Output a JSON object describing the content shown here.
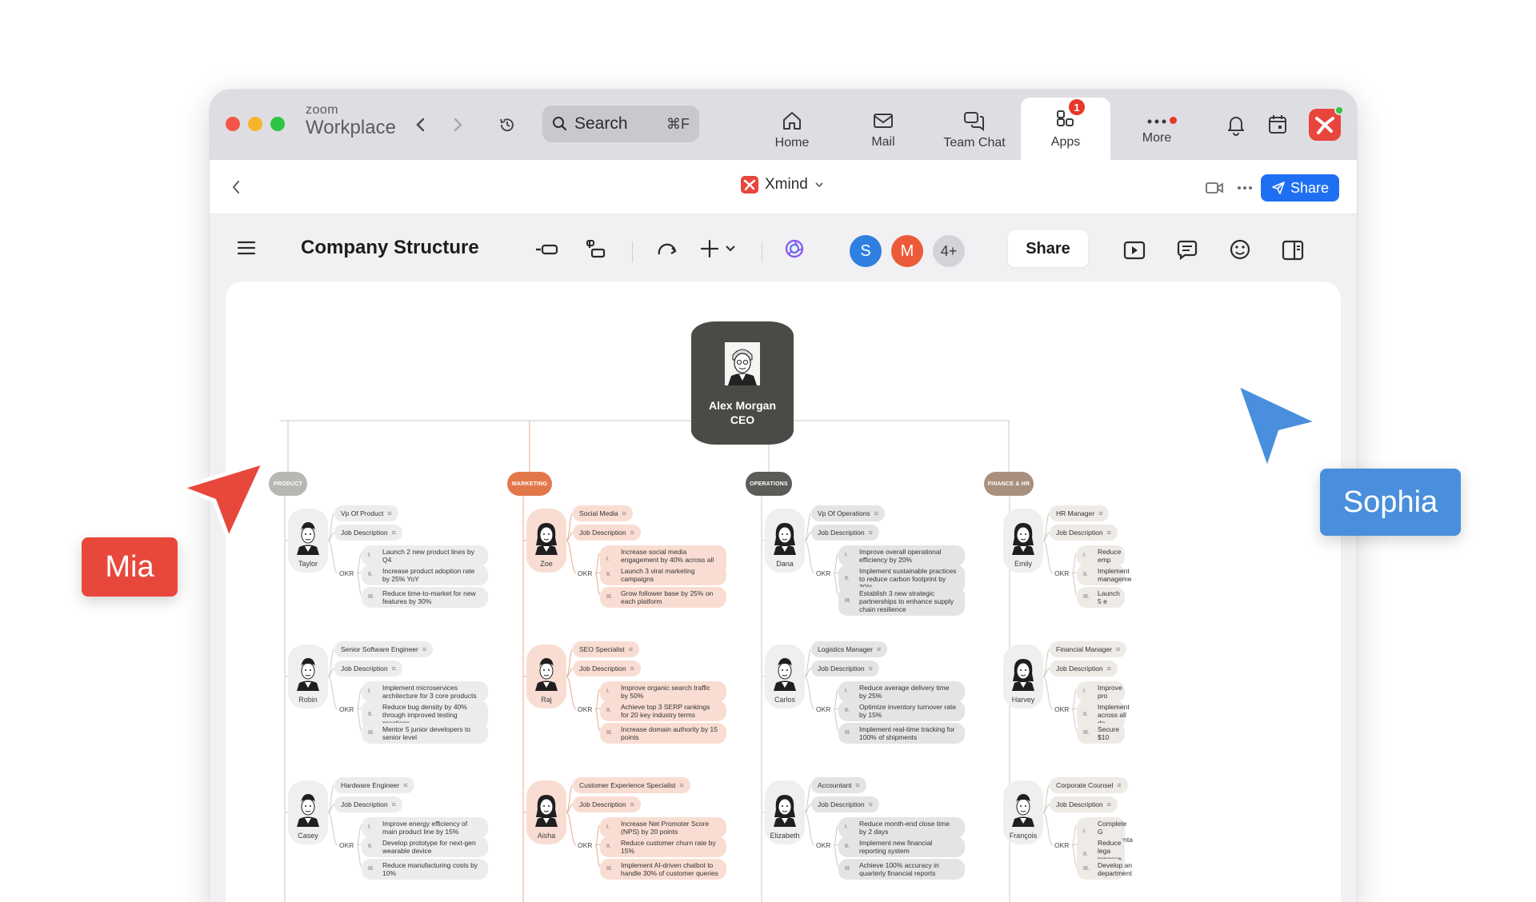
{
  "app": {
    "brand_top": "zoom",
    "brand_bottom": "Workplace",
    "search": {
      "placeholder": "Search",
      "shortcut": "⌘F"
    },
    "nav": [
      {
        "label": "Home",
        "icon": "home-icon"
      },
      {
        "label": "Mail",
        "icon": "mail-icon"
      },
      {
        "label": "Team Chat",
        "icon": "chat-icon"
      },
      {
        "label": "Apps",
        "icon": "apps-icon",
        "badge": "1",
        "active": true
      },
      {
        "label": "More",
        "icon": "more-icon"
      }
    ]
  },
  "appbar": {
    "app_name": "Xmind",
    "share_label": "Share"
  },
  "toolbar": {
    "title": "Company Structure",
    "collaborators": [
      {
        "initial": "S",
        "color": "#2f7fe0"
      },
      {
        "initial": "M",
        "color": "#ec5a3a"
      }
    ],
    "more_count": "4+",
    "share_label": "Share"
  },
  "map": {
    "ceo": {
      "name": "Alex Morgan",
      "role": "CEO"
    },
    "departments": [
      {
        "label": "PRODUCT",
        "color": "#b7b7b3",
        "chip_color": "#ececec",
        "people": [
          {
            "name": "Taylor",
            "role": "Vp Of Product",
            "goals": [
              "Launch 2 new product lines by Q4",
              "Increase product adoption rate by 25% YoY",
              "Reduce time-to-market for new features by 30%"
            ]
          },
          {
            "name": "Robin",
            "role": "Senior Software Engineer",
            "goals": [
              "Implement microservices architecture for 3 core products",
              "Reduce bug density by 40% through improved testing practices",
              "Mentor 5 junior developers to senior level"
            ]
          },
          {
            "name": "Casey",
            "role": "Hardware Engineer",
            "goals": [
              "Improve energy efficiency of main product line by 15%",
              "Develop prototype for next-gen wearable device",
              "Reduce manufacturing costs by 10%"
            ]
          }
        ]
      },
      {
        "label": "MARKETING",
        "color": "#e2784a",
        "chip_color": "#f9ddd3",
        "people": [
          {
            "name": "Zoe",
            "role": "Social Media",
            "goals": [
              "Increase social media engagement by 40% across all platforms",
              "Launch 3 viral marketing campaigns",
              "Grow follower base by 25% on each platform"
            ]
          },
          {
            "name": "Raj",
            "role": "SEO Specialist",
            "goals": [
              "Improve organic search traffic by 50%",
              "Achieve top 3 SERP rankings for 20 key industry terms",
              "Increase domain authority by 15 points"
            ]
          },
          {
            "name": "Aisha",
            "role": "Customer Experience Specialist",
            "goals": [
              "Increase Net Promoter Score (NPS) by 20 points",
              "Reduce customer churn rate by 15%",
              "Implement AI-driven chatbot to handle 30% of customer queries"
            ]
          }
        ]
      },
      {
        "label": "OPERATIONS",
        "color": "#5b5b58",
        "chip_color": "#e4e4e2",
        "people": [
          {
            "name": "Dana",
            "role": "Vp Of Operations",
            "goals": [
              "Improve overall operational efficiency by 20%",
              "Implement sustainable practices to reduce carbon footprint by 30%",
              "Establish 3 new strategic partnerships to enhance supply chain resilience"
            ]
          },
          {
            "name": "Carlos",
            "role": "Logistics Manager",
            "goals": [
              "Reduce average delivery time by 25%",
              "Optimize inventory turnover rate by 15%",
              "Implement real-time tracking for 100% of shipments"
            ]
          },
          {
            "name": "Elizabeth",
            "role": "Accountant",
            "goals": [
              "Reduce month-end close time by 2 days",
              "Implement new financial reporting system",
              "Achieve 100% accuracy in quarterly financial reports"
            ]
          }
        ]
      },
      {
        "label": "FINANCE & HR",
        "color": "#a98f7e",
        "chip_color": "#eeeae6",
        "people": [
          {
            "name": "Emily",
            "role": "HR Manager",
            "goals": [
              "Reduce emp",
              "Implement manageme",
              "Launch 5 e"
            ]
          },
          {
            "name": "Harvey",
            "role": "Financial  Manager",
            "goals": [
              "Improve pro",
              "Implement across all de",
              "Secure $10"
            ]
          },
          {
            "name": "François",
            "role": "Corporate Counsel",
            "goals": [
              "Complete G implementa",
              "Reduce lega process opt",
              "Develop an department"
            ]
          }
        ]
      }
    ],
    "job_description_label": "Job Description",
    "okr_label": "OKR",
    "numerals": [
      "I.",
      "II.",
      "III."
    ]
  },
  "cursors": [
    {
      "name": "Mia",
      "color": "#e8483c"
    },
    {
      "name": "Sophia",
      "color": "#4a8fdd"
    }
  ]
}
